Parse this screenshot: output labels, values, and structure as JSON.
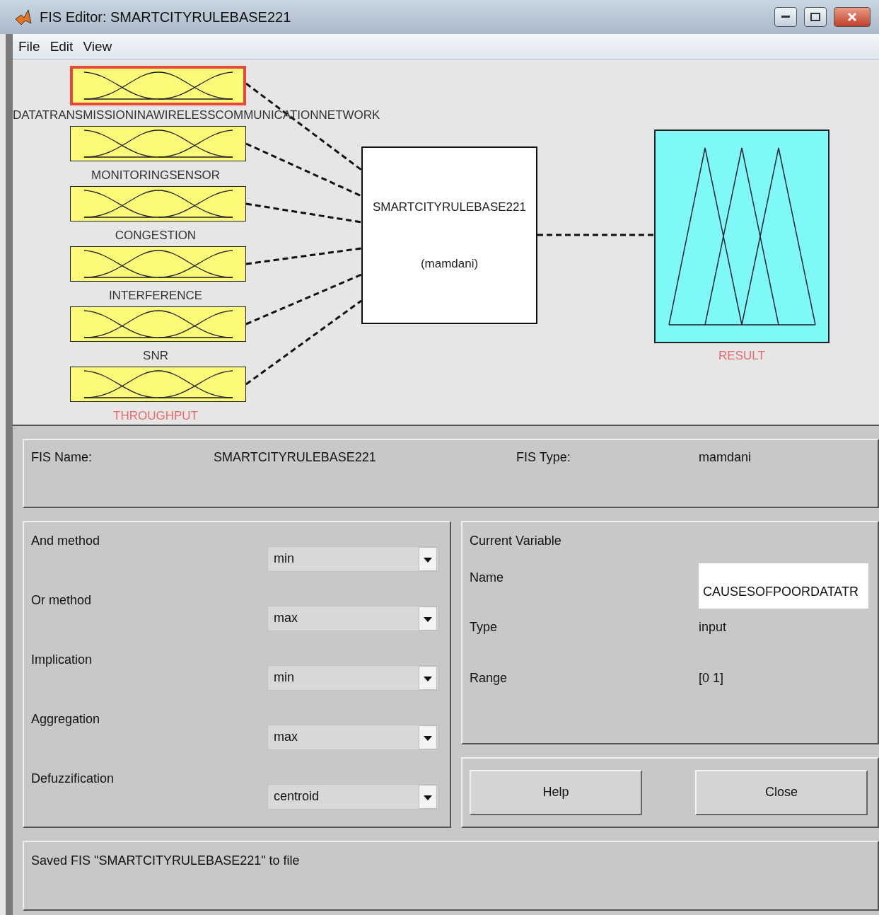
{
  "window": {
    "title": "FIS Editor: SMARTCITYRULEBASE221"
  },
  "menu": [
    "File",
    "Edit",
    "View"
  ],
  "diagram": {
    "inputs": [
      {
        "label": "DATATRANSMISSIONINAWIRELESSCOMMUNICATIONNETWORK",
        "selected": true,
        "color": "#333333"
      },
      {
        "label": "MONITORINGSENSOR",
        "selected": false,
        "color": "#333333"
      },
      {
        "label": "CONGESTION",
        "selected": false,
        "color": "#333333"
      },
      {
        "label": "INTERFERENCE",
        "selected": false,
        "color": "#333333"
      },
      {
        "label": "SNR",
        "selected": false,
        "color": "#333333"
      },
      {
        "label": "THROUGHPUT",
        "selected": false,
        "color": "#e86a6a"
      }
    ],
    "system": {
      "name": "SMARTCITYRULEBASE221",
      "type": "(mamdani)"
    },
    "outputs": [
      {
        "label": "RESULT",
        "selected": false,
        "color": "#e86a6a"
      }
    ]
  },
  "fis": {
    "name_label": "FIS Name:",
    "name": "SMARTCITYRULEBASE221",
    "type_label": "FIS Type:",
    "type": "mamdani"
  },
  "methods": [
    {
      "label": "And method",
      "value": "min"
    },
    {
      "label": "Or method",
      "value": "max"
    },
    {
      "label": "Implication",
      "value": "min"
    },
    {
      "label": "Aggregation",
      "value": "max"
    },
    {
      "label": "Defuzzification",
      "value": "centroid"
    }
  ],
  "current_variable": {
    "title": "Current Variable",
    "name_label": "Name",
    "name": "CAUSESOFPOORDATATR",
    "type_label": "Type",
    "type": "input",
    "range_label": "Range",
    "range": "[0 1]"
  },
  "buttons": [
    "Help",
    "Close"
  ],
  "status": "Saved FIS \"SMARTCITYRULEBASE221\" to file"
}
